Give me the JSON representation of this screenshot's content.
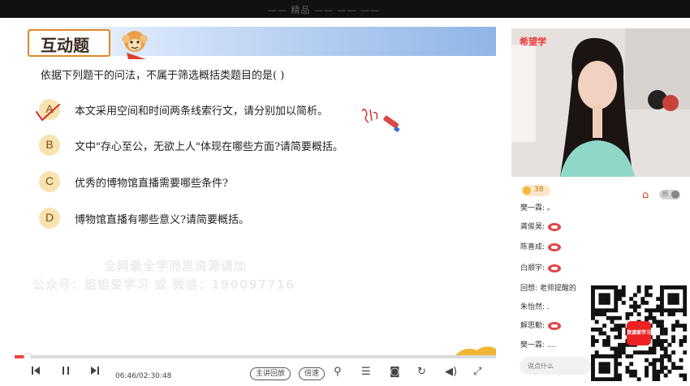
{
  "window": {
    "title_fragment": "—— 精品 —— —— ——"
  },
  "slide": {
    "title": "互动题",
    "question": "依据下列题干的问法，不属于筛选概括类题目的是( )",
    "options": [
      {
        "letter": "A",
        "text": "本文采用空间和时间两条线索行文，请分别加以简析。"
      },
      {
        "letter": "B",
        "text": "文中\"存心至公，无欲上人\"体现在哪些方面?请简要概括。"
      },
      {
        "letter": "C",
        "text": "优秀的博物馆直播需要哪些条件?"
      },
      {
        "letter": "D",
        "text": "博物馆直播有哪些意义?请简要概括。"
      }
    ],
    "watermark_line1": "全网最全学而思资源请加",
    "watermark_line2": "公众号：姐姐爱学习 或 微信：190097716",
    "colors": {
      "option_circle": "#f8e2b0",
      "accent": "#e0892a",
      "header": "#8fb5e6"
    }
  },
  "player": {
    "progress": 0.027,
    "time": "06:46/02:30:48",
    "replay_label": "主讲回放",
    "speed_label": "倍速",
    "icons": [
      "skip-back-icon",
      "pause-icon",
      "skip-forward-icon",
      "pin-icon",
      "subtitle-icon",
      "record-icon",
      "loop-icon",
      "volume-icon",
      "fullscreen-icon"
    ]
  },
  "side": {
    "logo": "希望学",
    "likes": "38",
    "toggle_label": "师",
    "chat": [
      {
        "name": "樊一霖:",
        "text": "。",
        "emoji": false
      },
      {
        "name": "龚俊昊:",
        "text": "",
        "emoji": true
      },
      {
        "name": "陈喜成:",
        "text": "",
        "emoji": true
      },
      {
        "name": "白顺宇:",
        "text": "",
        "emoji": true
      },
      {
        "name": "回想:",
        "text": "老师提醒的",
        "emoji": false
      },
      {
        "name": "朱怡然:",
        "text": ".",
        "emoji": false
      },
      {
        "name": "解思勤:",
        "text": "",
        "emoji": true
      },
      {
        "name": "樊一霖:",
        "text": "....",
        "emoji": false
      }
    ],
    "input_placeholder": "说点什么",
    "qr_caption": "资源爱学习"
  }
}
